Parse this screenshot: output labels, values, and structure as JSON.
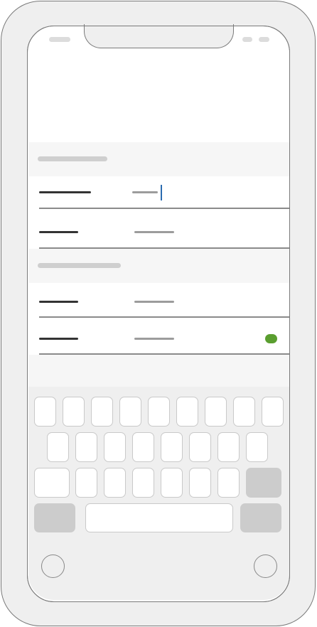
{
  "status_bar": {
    "left": "",
    "right_icons": [
      "signal-icon",
      "battery-icon"
    ]
  },
  "form": {
    "caret_color": "#2b6cb0",
    "toggle_color": "#5a9e2f",
    "sections": [
      {
        "header": "",
        "rows": [
          {
            "label": "",
            "value": "",
            "focused": true
          },
          {
            "label": "",
            "value": ""
          }
        ]
      },
      {
        "header": "",
        "rows": [
          {
            "label": "",
            "value": ""
          },
          {
            "label": "",
            "value": "",
            "toggle_on": true
          }
        ]
      }
    ]
  },
  "keyboard": {
    "row1": [
      "",
      "",
      "",
      "",
      "",
      "",
      "",
      "",
      ""
    ],
    "row2": [
      "",
      "",
      "",
      "",
      "",
      "",
      "",
      ""
    ],
    "row3": [
      "",
      "",
      "",
      "",
      "",
      "",
      "",
      ""
    ],
    "row4": [
      "",
      "",
      ""
    ]
  }
}
